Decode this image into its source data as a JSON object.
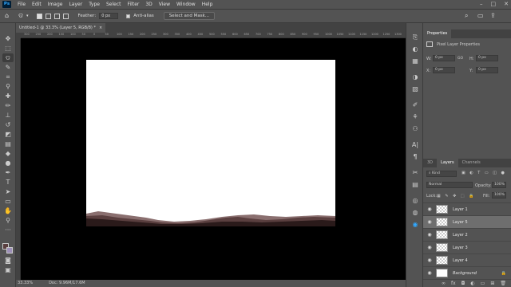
{
  "menubar": {
    "logo": "Ps",
    "items": [
      "File",
      "Edit",
      "Image",
      "Layer",
      "Type",
      "Select",
      "Filter",
      "3D",
      "View",
      "Window",
      "Help"
    ]
  },
  "options": {
    "feather_label": "Feather:",
    "feather_value": "0 px",
    "antialias_label": "Anti-alias",
    "select_mask_label": "Select and Mask..."
  },
  "document": {
    "tab_title": "Untitled-1 @ 33.3% (Layer 5, RGB/8) *",
    "close": "×",
    "zoom": "33.33%",
    "doc_info": "Doc: 9.96M/17.6M"
  },
  "ruler": {
    "h_ticks": [
      "300",
      "250",
      "200",
      "150",
      "100",
      "50",
      "0",
      "50",
      "100",
      "150",
      "200",
      "250",
      "300",
      "350",
      "400",
      "450",
      "500",
      "550",
      "600",
      "650",
      "700",
      "750",
      "800",
      "850",
      "900",
      "950",
      "1000",
      "1050",
      "1100",
      "1150",
      "1200",
      "1250",
      "1300"
    ]
  },
  "properties": {
    "tab": "Properties",
    "title": "Pixel Layer Properties",
    "w_label": "W:",
    "w_value": "0 px",
    "h_label": "H:",
    "h_value": "0 px",
    "link": "GO",
    "x_label": "X:",
    "x_value": "0 px",
    "y_label": "Y:",
    "y_value": "0 px"
  },
  "layers_panel": {
    "tabs": [
      "3D",
      "Layers",
      "Channels"
    ],
    "kind_label": "Kind",
    "blend_mode": "Normal",
    "opacity_label": "Opacity:",
    "opacity_value": "100%",
    "lock_label": "Lock:",
    "fill_label": "Fill:",
    "fill_value": "100%",
    "layers": [
      {
        "name": "Layer 1",
        "selected": false
      },
      {
        "name": "Layer 5",
        "selected": true
      },
      {
        "name": "Layer 2",
        "selected": false
      },
      {
        "name": "Layer 3",
        "selected": false
      },
      {
        "name": "Layer 4",
        "selected": false
      },
      {
        "name": "Background",
        "selected": false
      }
    ]
  },
  "colors": {
    "accent": "#31a8ff",
    "canvas_bg": "#000000",
    "mountain_dark": "#2a1a1a",
    "mountain_mid": "#5a3f3f",
    "mountain_light": "#8a6f6f"
  }
}
